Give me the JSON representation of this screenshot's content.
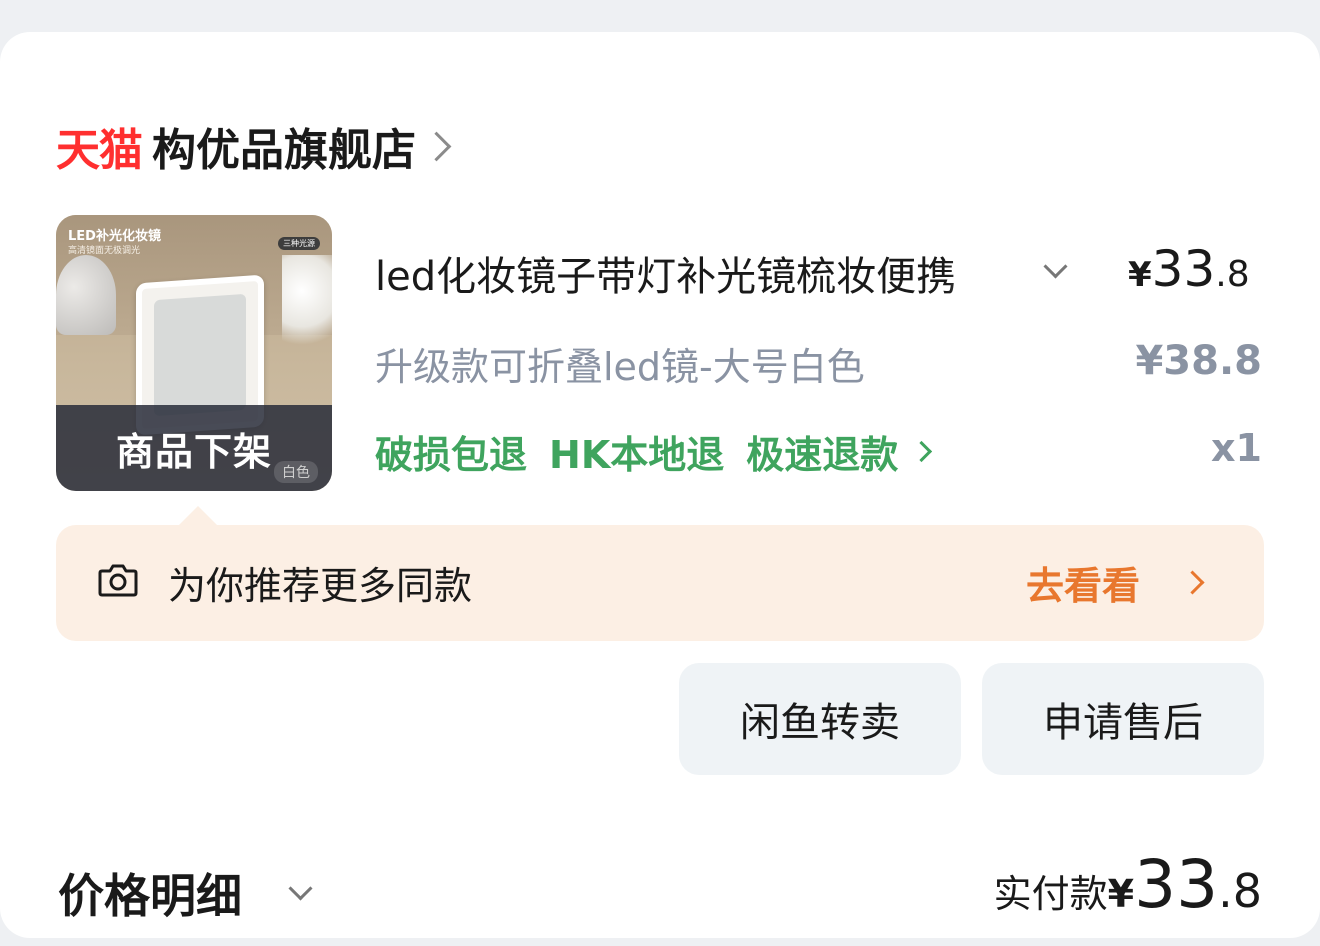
{
  "store": {
    "platform_label": "天猫",
    "name": "构优品旗舰店"
  },
  "item": {
    "title": "led化妆镜子带灯补光镜梳妆便携",
    "price": {
      "currency": "¥",
      "integer": "33",
      "decimal": ".8"
    },
    "sku": "升级款可折叠led镜-大号白色",
    "original_price": "¥38.8",
    "quantity": "x1",
    "service_tags": [
      "破损包退",
      "HK本地退",
      "极速退款"
    ],
    "thumb": {
      "overlay": "商品下架",
      "title": "LED补光化妆镜",
      "subtitle": "高清镜面无极调光",
      "badge": "三种光源",
      "color_chip": "白色"
    }
  },
  "recommend": {
    "text": "为你推荐更多同款",
    "link": "去看看"
  },
  "actions": {
    "resell": "闲鱼转卖",
    "after_sale": "申请售后"
  },
  "footer": {
    "price_detail": "价格明细",
    "paid_label": "实付款",
    "paid": {
      "currency": "¥",
      "integer": "33",
      "decimal": ".8"
    }
  },
  "colors": {
    "tmall_red": "#ff2f2f",
    "service_green": "#3fa45e",
    "link_orange": "#e8772e",
    "muted_gray": "#8a93a3",
    "recommend_bg": "#fcefe4",
    "button_bg": "#eff3f6"
  }
}
